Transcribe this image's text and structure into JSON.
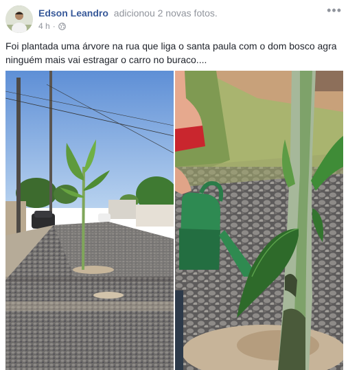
{
  "post": {
    "author": "Edson Leandro",
    "action": "adicionou 2 novas fotos.",
    "time": "4 h",
    "dot": "·",
    "more_label": "•••",
    "caption": "Foi plantada uma árvore na rua que liga o santa paula com o dom bosco agra ninguém mais vai estragar o carro no buraco...."
  },
  "icons": {
    "privacy": "globe-icon",
    "menu": "more-options-icon"
  },
  "colors": {
    "author_link": "#365899",
    "meta_text": "#90949c",
    "body_text": "#1d2129"
  }
}
